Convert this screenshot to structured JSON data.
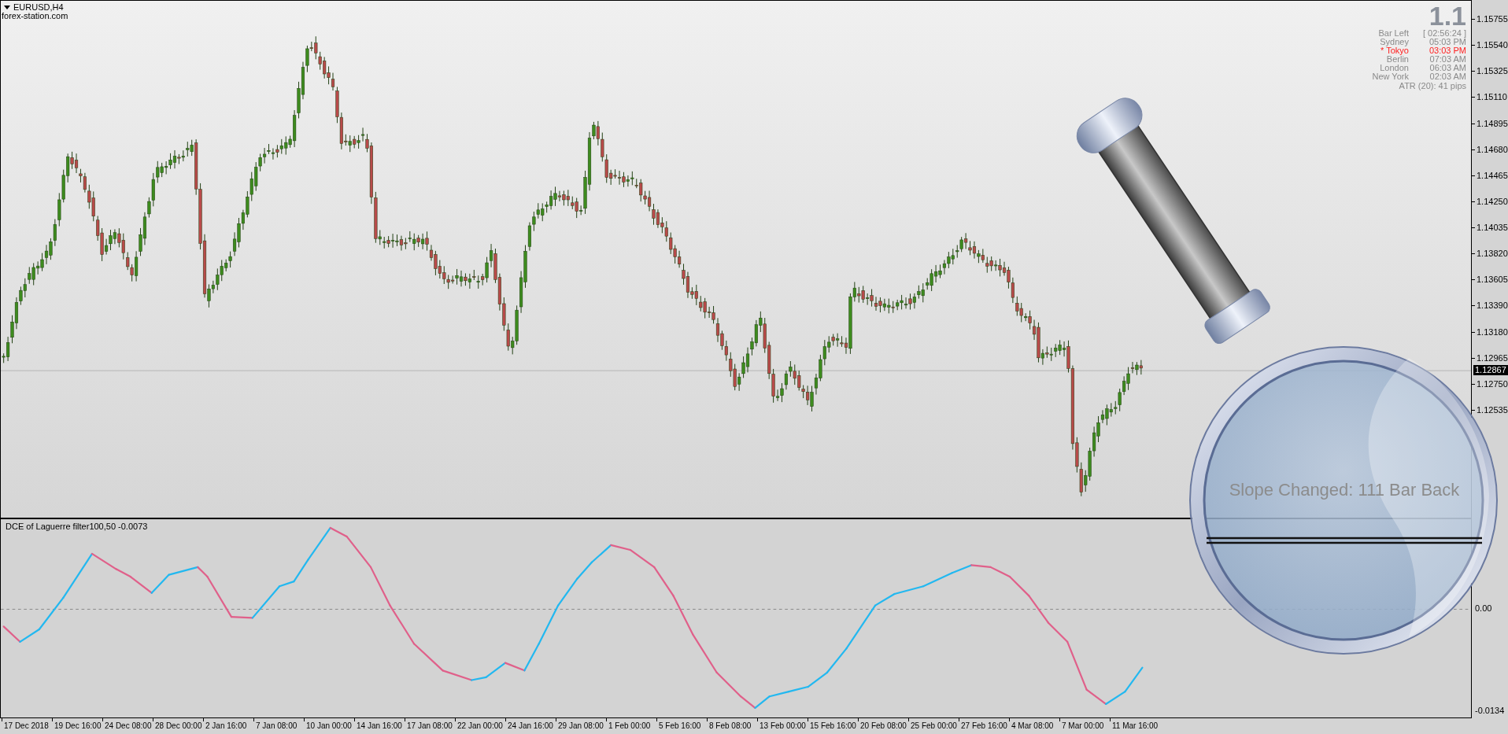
{
  "chart": {
    "symbol": "EURUSD,H4",
    "watermark": "forex-station.com"
  },
  "info_panel": {
    "version": "1.1",
    "rows": [
      {
        "label": "Bar Left",
        "value": "[ 02:56:24 ]",
        "highlighted": false
      },
      {
        "label": "Sydney",
        "value": "05:03 PM",
        "highlighted": false
      },
      {
        "label": "* Tokyo",
        "value": "03:03 PM",
        "highlighted": true
      },
      {
        "label": "Berlin",
        "value": "07:03 AM",
        "highlighted": false
      },
      {
        "label": "London",
        "value": "06:03 AM",
        "highlighted": false
      },
      {
        "label": "New York",
        "value": "02:03 AM",
        "highlighted": false
      }
    ],
    "footer": "ATR (20): 41 pips"
  },
  "price_axis": {
    "labels": [
      "1.15755",
      "1.15540",
      "1.15325",
      "1.15110",
      "1.14895",
      "1.14680",
      "1.14465",
      "1.14250",
      "1.14035",
      "1.13820",
      "1.13605",
      "1.13390",
      "1.13180",
      "1.12965",
      "1.12750",
      "1.12535"
    ],
    "current_price": "1.12867"
  },
  "indicator": {
    "title": "DCE of Laguerre filter100,50 -0.0073",
    "axis_labels": [
      "0.00",
      "-0.0134"
    ]
  },
  "time_axis": {
    "labels": [
      "17 Dec 2018",
      "19 Dec 16:00",
      "24 Dec 08:00",
      "28 Dec 00:00",
      "2 Jan 16:00",
      "7 Jan 08:00",
      "10 Jan 00:00",
      "14 Jan 16:00",
      "17 Jan 08:00",
      "22 Jan 00:00",
      "24 Jan 16:00",
      "29 Jan 08:00",
      "1 Feb 00:00",
      "5 Feb 16:00",
      "8 Feb 08:00",
      "13 Feb 00:00",
      "15 Feb 16:00",
      "20 Feb 08:00",
      "25 Feb 00:00",
      "27 Feb 16:00",
      "4 Mar 08:00",
      "7 Mar 00:00",
      "11 Mar 16:00"
    ]
  },
  "magnifier": {
    "message": "Slope Changed: 111 Bar Back"
  }
}
